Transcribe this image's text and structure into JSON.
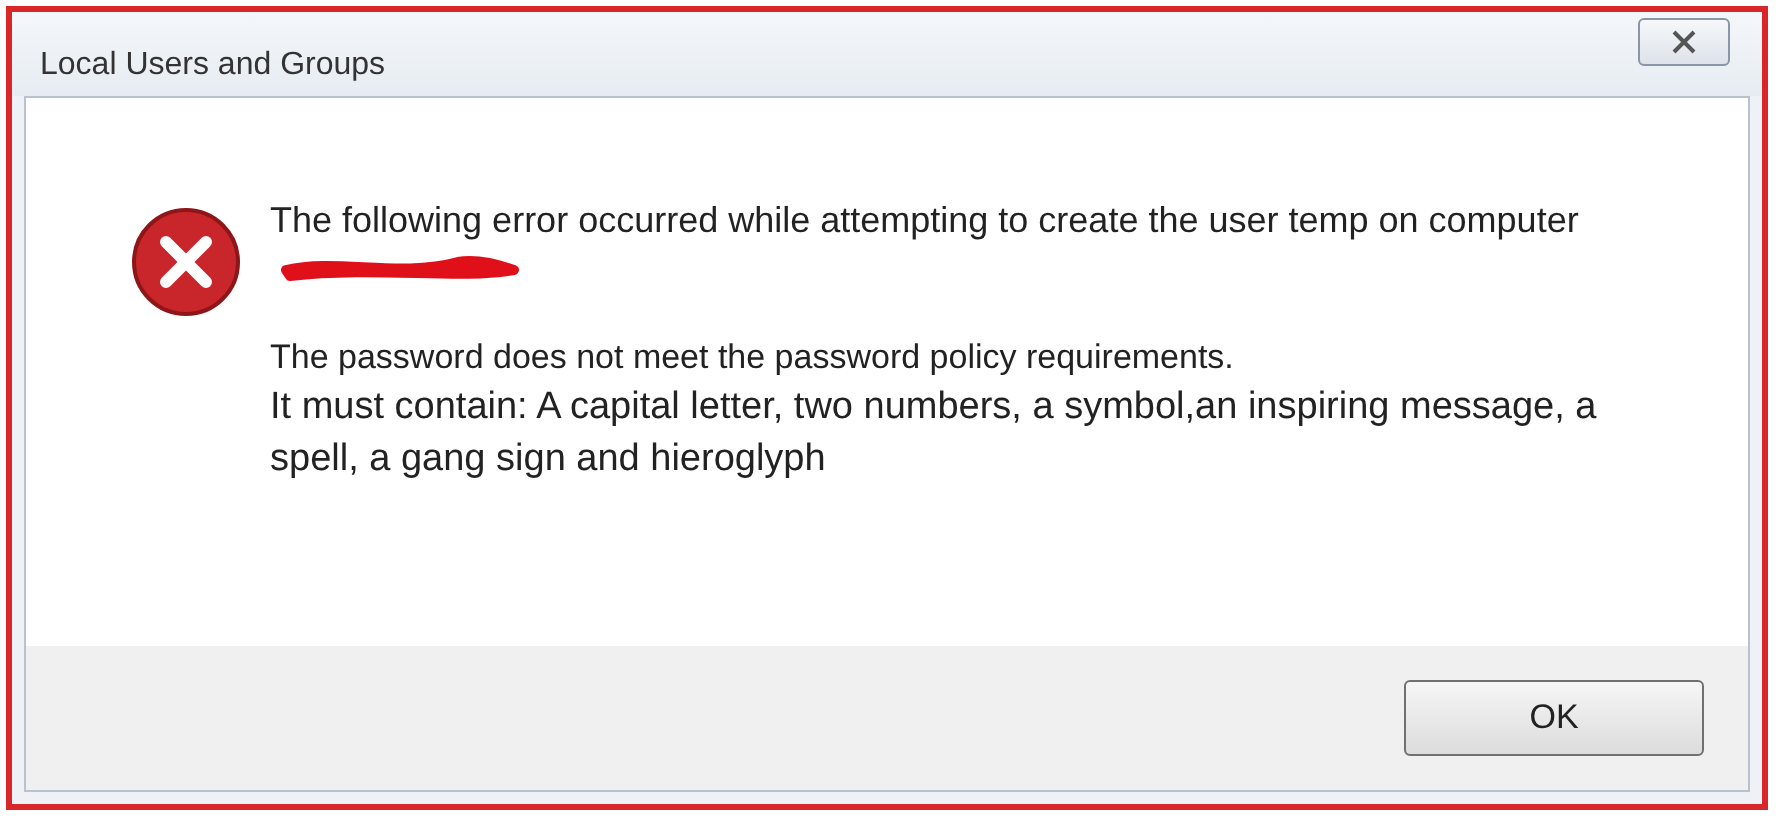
{
  "window": {
    "title": "Local Users and Groups"
  },
  "error_text": "The following error occurred while attempting to create the user temp on computer",
  "policy_text": "The password does not meet the password policy requirements.",
  "requirements_text": "It must contain: A capital letter, two numbers, a symbol,an inspiring message, a spell, a gang sign and hieroglyph",
  "buttons": [
    {
      "label": "OK"
    }
  ]
}
